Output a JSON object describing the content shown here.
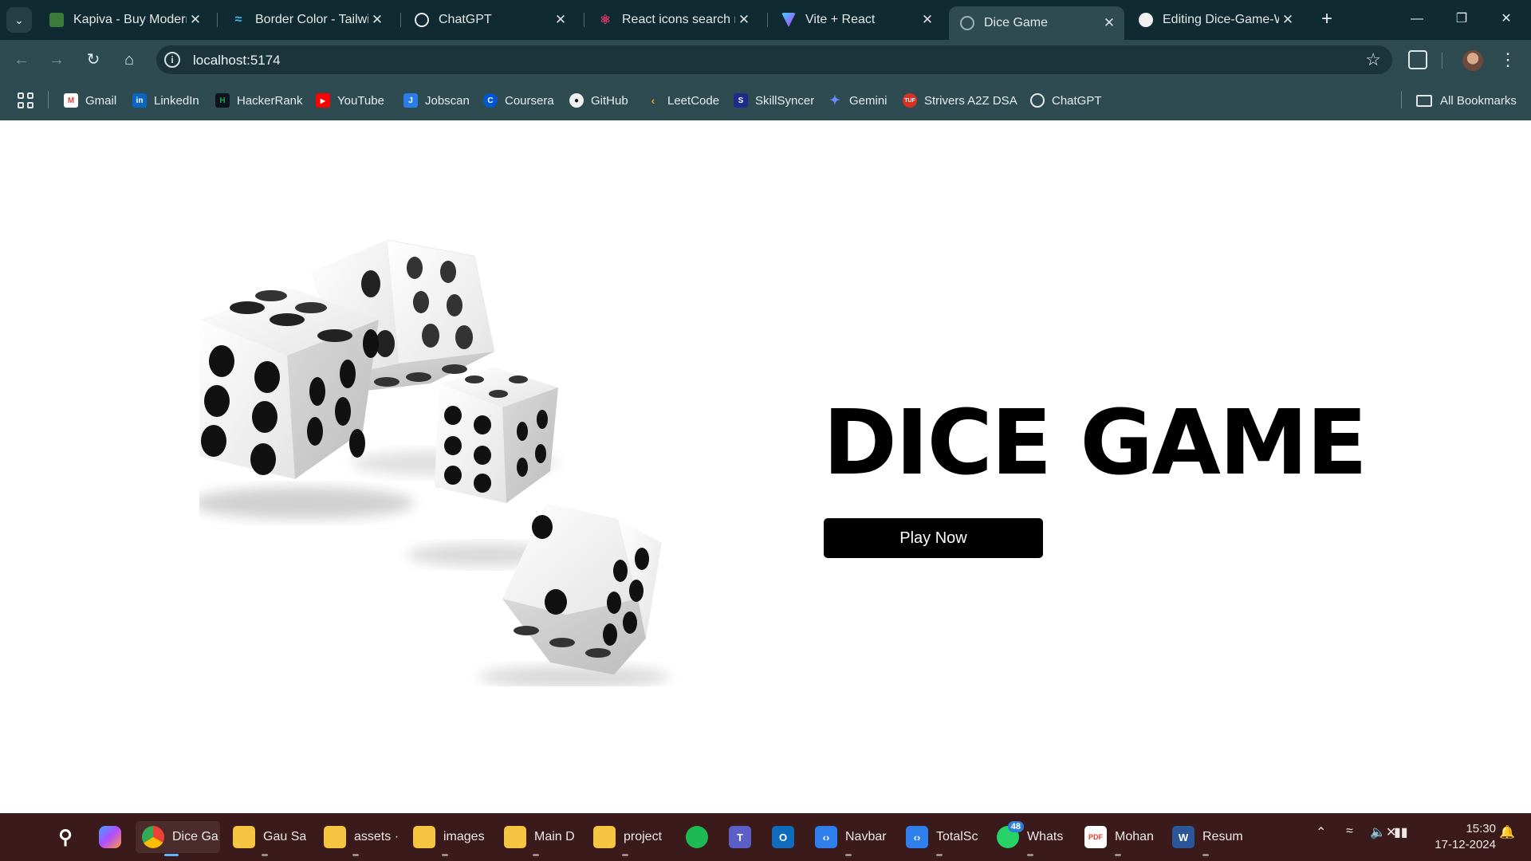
{
  "browser": {
    "tabs": [
      {
        "title": "Kapiva - Buy Modern",
        "icon": "kapiva-icon",
        "color": "#3b7a3b"
      },
      {
        "title": "Border Color - Tailwi",
        "icon": "tailwind-icon",
        "color": "#38bdf8"
      },
      {
        "title": "ChatGPT",
        "icon": "chatgpt-icon",
        "color": "#e8e8e8"
      },
      {
        "title": "React icons search re",
        "icon": "react-icon",
        "color": "#e0356a"
      },
      {
        "title": "Vite + React",
        "icon": "vite-icon",
        "color": "#a855f7"
      },
      {
        "title": "Dice Game",
        "icon": "globe-icon",
        "color": "#9fb3b7",
        "active": true
      },
      {
        "title": "Editing Dice-Game-W",
        "icon": "github-icon",
        "color": "#f0f0f0"
      }
    ],
    "address": "localhost:5174",
    "bookmarks": [
      {
        "label": "Gmail",
        "icon": "gmail-icon",
        "color": "#ea4335"
      },
      {
        "label": "LinkedIn",
        "icon": "linkedin-icon",
        "color": "#0a66c2"
      },
      {
        "label": "HackerRank",
        "icon": "hackerrank-icon",
        "color": "#1ba94c"
      },
      {
        "label": "YouTube",
        "icon": "youtube-icon",
        "color": "#ff0000"
      },
      {
        "label": "Jobscan",
        "icon": "jobscan-icon",
        "color": "#2b7de9"
      },
      {
        "label": "Coursera",
        "icon": "coursera-icon",
        "color": "#0056d2"
      },
      {
        "label": "GitHub",
        "icon": "github-icon",
        "color": "#f0f0f0"
      },
      {
        "label": "LeetCode",
        "icon": "leetcode-icon",
        "color": "#f89f1b"
      },
      {
        "label": "SkillSyncer",
        "icon": "skillsyncer-icon",
        "color": "#1f2b8c"
      },
      {
        "label": "Gemini",
        "icon": "gemini-icon",
        "color": "#6a8cff"
      },
      {
        "label": "Strivers A2Z DSA",
        "icon": "tuf-icon",
        "color": "#d93025"
      },
      {
        "label": "ChatGPT",
        "icon": "chatgpt-icon",
        "color": "#e8e8e8"
      }
    ],
    "all_bookmarks": "All Bookmarks"
  },
  "page": {
    "title": "DICE GAME",
    "play_button": "Play Now"
  },
  "taskbar": {
    "items": [
      {
        "label": "Dice Ga",
        "icon": "chrome-icon",
        "color": "#e8453c",
        "active": true
      },
      {
        "label": "Gau Sa",
        "icon": "folder-icon",
        "color": "#f5c542"
      },
      {
        "label": "assets ·",
        "icon": "folder-icon",
        "color": "#f5c542"
      },
      {
        "label": "images",
        "icon": "folder-icon",
        "color": "#f5c542"
      },
      {
        "label": "Main D",
        "icon": "folder-icon",
        "color": "#f5c542"
      },
      {
        "label": "project",
        "icon": "folder-icon",
        "color": "#f5c542"
      },
      {
        "label": "",
        "icon": "spotify-icon",
        "color": "#1db954"
      },
      {
        "label": "",
        "icon": "teams-icon",
        "color": "#5b5fc7"
      },
      {
        "label": "",
        "icon": "outlook-icon",
        "color": "#0f6cbd"
      },
      {
        "label": "Navbar",
        "icon": "vscode-icon",
        "color": "#2f80ed"
      },
      {
        "label": "TotalSc",
        "icon": "vscode-icon",
        "color": "#2f80ed"
      },
      {
        "label": "Whats",
        "icon": "whatsapp-icon",
        "color": "#25d366",
        "badge": "48"
      },
      {
        "label": "Mohan",
        "icon": "pdf-icon",
        "color": "#e33b2e"
      },
      {
        "label": "Resum",
        "icon": "word-icon",
        "color": "#2b579a"
      }
    ],
    "time": "15:30",
    "date": "17-12-2024"
  },
  "colors": {
    "chrome_dark": "#0f2a30",
    "chrome": "#2e4b51",
    "taskbar": "#3a1a1a",
    "button_bg": "#000000",
    "button_text": "#ffffff"
  }
}
